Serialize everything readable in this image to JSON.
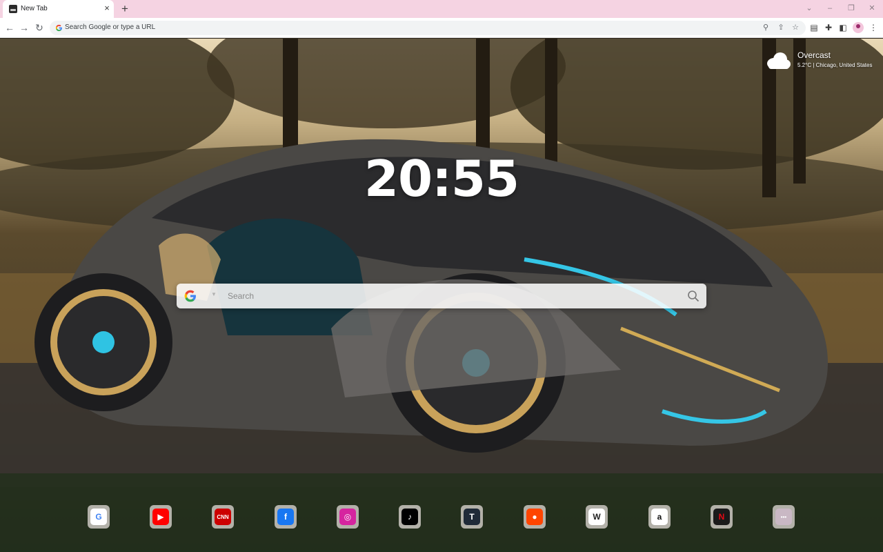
{
  "browser": {
    "tab": {
      "title": "New Tab",
      "close_icon": "close-icon"
    },
    "new_tab_label": "+",
    "window_controls": [
      "chevron-down-icon",
      "minimize-icon",
      "restore-icon",
      "close-icon"
    ],
    "omnibox": {
      "placeholder": "Search Google or type a URL"
    },
    "toolbar_icons": [
      "location-icon",
      "share-icon",
      "bookmark-star-icon",
      "extension-icon",
      "puzzle-icon",
      "side-panel-icon",
      "profile-avatar",
      "menu-icon"
    ]
  },
  "weather": {
    "condition": "Overcast",
    "detail": "5.2°C | Chicago, United States",
    "icon": "cloud-icon"
  },
  "clock": {
    "time": "20:55"
  },
  "search": {
    "placeholder": "Search",
    "engine_icon": "google-icon"
  },
  "shortcuts": [
    {
      "name": "google",
      "glyph": "G",
      "bg": "#ffffff",
      "fg": "#4285f4"
    },
    {
      "name": "youtube",
      "glyph": "▶",
      "bg": "#ff0000",
      "fg": "#ffffff"
    },
    {
      "name": "cnn",
      "glyph": "CNN",
      "bg": "#cc0000",
      "fg": "#ffffff"
    },
    {
      "name": "facebook",
      "glyph": "f",
      "bg": "#1877f2",
      "fg": "#ffffff"
    },
    {
      "name": "instagram",
      "glyph": "◎",
      "bg": "#d6249f",
      "fg": "#ffffff"
    },
    {
      "name": "tiktok",
      "glyph": "♪",
      "bg": "#000000",
      "fg": "#ffffff"
    },
    {
      "name": "tumblr",
      "glyph": "T",
      "bg": "#1f2a38",
      "fg": "#ffffff"
    },
    {
      "name": "reddit",
      "glyph": "●",
      "bg": "#ff4500",
      "fg": "#ffffff"
    },
    {
      "name": "wikipedia",
      "glyph": "W",
      "bg": "#ffffff",
      "fg": "#222222"
    },
    {
      "name": "amazon",
      "glyph": "a",
      "bg": "#ffffff",
      "fg": "#111111"
    },
    {
      "name": "netflix",
      "glyph": "N",
      "bg": "#1a1a1a",
      "fg": "#e50914"
    },
    {
      "name": "more",
      "glyph": "•••",
      "bg": "#c9b8c4",
      "fg": "#ffffff"
    }
  ]
}
